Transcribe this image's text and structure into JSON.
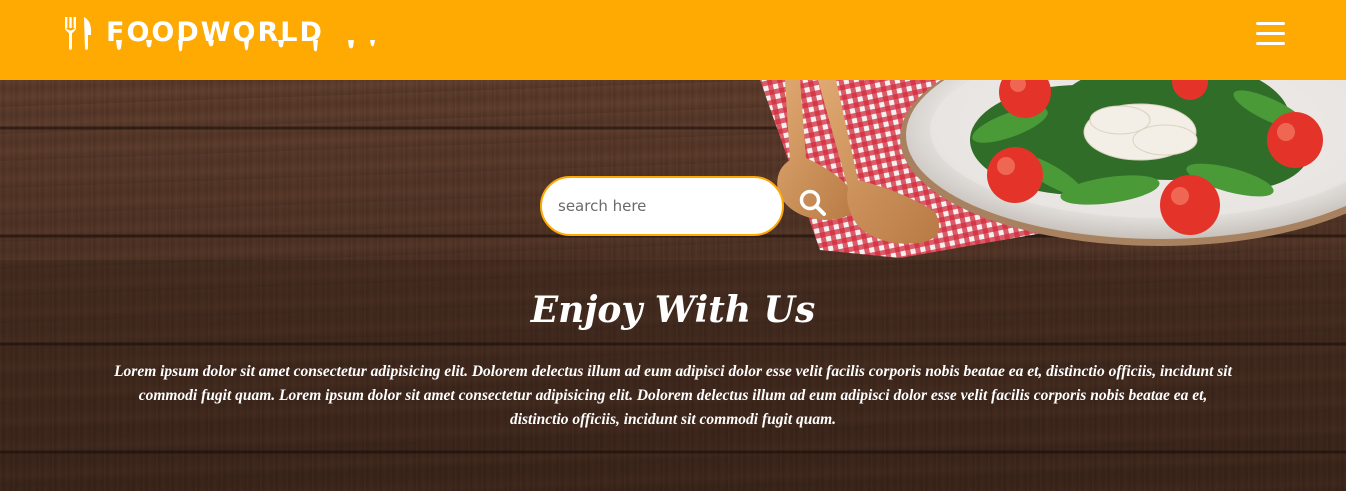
{
  "navbar": {
    "brand": "FOODWORLD",
    "brand_icon": "fork-knife-icon",
    "menu_icon": "hamburger-menu-icon",
    "background_color": "#ffa903"
  },
  "hero": {
    "search": {
      "placeholder": "search here",
      "button_icon": "search-icon"
    },
    "title": "Enjoy With Us",
    "text": "Lorem ipsum dolor sit amet consectetur adipisicing elit. Dolorem delectus illum ad eum adipisci dolor esse velit facilis corporis nobis beatae ea et, distinctio officiis, incidunt sit commodi fugit quam. Lorem ipsum dolor sit amet consectetur adipisicing elit. Dolorem delectus illum ad eum adipisci dolor esse velit facilis corporis nobis beatae ea et, distinctio officiis, incidunt sit commodi fugit quam.",
    "background_image": "salad-plate-wooden-table-photo"
  }
}
